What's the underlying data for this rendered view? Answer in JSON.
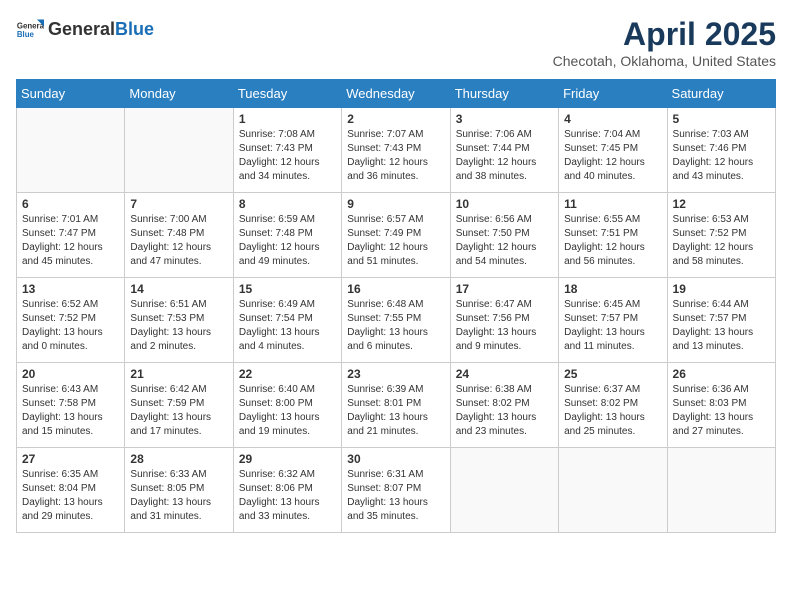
{
  "header": {
    "logo_general": "General",
    "logo_blue": "Blue",
    "main_title": "April 2025",
    "subtitle": "Checotah, Oklahoma, United States"
  },
  "days_of_week": [
    "Sunday",
    "Monday",
    "Tuesday",
    "Wednesday",
    "Thursday",
    "Friday",
    "Saturday"
  ],
  "weeks": [
    [
      {
        "day": "",
        "sunrise": "",
        "sunset": "",
        "daylight": ""
      },
      {
        "day": "",
        "sunrise": "",
        "sunset": "",
        "daylight": ""
      },
      {
        "day": "1",
        "sunrise": "Sunrise: 7:08 AM",
        "sunset": "Sunset: 7:43 PM",
        "daylight": "Daylight: 12 hours and 34 minutes."
      },
      {
        "day": "2",
        "sunrise": "Sunrise: 7:07 AM",
        "sunset": "Sunset: 7:43 PM",
        "daylight": "Daylight: 12 hours and 36 minutes."
      },
      {
        "day": "3",
        "sunrise": "Sunrise: 7:06 AM",
        "sunset": "Sunset: 7:44 PM",
        "daylight": "Daylight: 12 hours and 38 minutes."
      },
      {
        "day": "4",
        "sunrise": "Sunrise: 7:04 AM",
        "sunset": "Sunset: 7:45 PM",
        "daylight": "Daylight: 12 hours and 40 minutes."
      },
      {
        "day": "5",
        "sunrise": "Sunrise: 7:03 AM",
        "sunset": "Sunset: 7:46 PM",
        "daylight": "Daylight: 12 hours and 43 minutes."
      }
    ],
    [
      {
        "day": "6",
        "sunrise": "Sunrise: 7:01 AM",
        "sunset": "Sunset: 7:47 PM",
        "daylight": "Daylight: 12 hours and 45 minutes."
      },
      {
        "day": "7",
        "sunrise": "Sunrise: 7:00 AM",
        "sunset": "Sunset: 7:48 PM",
        "daylight": "Daylight: 12 hours and 47 minutes."
      },
      {
        "day": "8",
        "sunrise": "Sunrise: 6:59 AM",
        "sunset": "Sunset: 7:48 PM",
        "daylight": "Daylight: 12 hours and 49 minutes."
      },
      {
        "day": "9",
        "sunrise": "Sunrise: 6:57 AM",
        "sunset": "Sunset: 7:49 PM",
        "daylight": "Daylight: 12 hours and 51 minutes."
      },
      {
        "day": "10",
        "sunrise": "Sunrise: 6:56 AM",
        "sunset": "Sunset: 7:50 PM",
        "daylight": "Daylight: 12 hours and 54 minutes."
      },
      {
        "day": "11",
        "sunrise": "Sunrise: 6:55 AM",
        "sunset": "Sunset: 7:51 PM",
        "daylight": "Daylight: 12 hours and 56 minutes."
      },
      {
        "day": "12",
        "sunrise": "Sunrise: 6:53 AM",
        "sunset": "Sunset: 7:52 PM",
        "daylight": "Daylight: 12 hours and 58 minutes."
      }
    ],
    [
      {
        "day": "13",
        "sunrise": "Sunrise: 6:52 AM",
        "sunset": "Sunset: 7:52 PM",
        "daylight": "Daylight: 13 hours and 0 minutes."
      },
      {
        "day": "14",
        "sunrise": "Sunrise: 6:51 AM",
        "sunset": "Sunset: 7:53 PM",
        "daylight": "Daylight: 13 hours and 2 minutes."
      },
      {
        "day": "15",
        "sunrise": "Sunrise: 6:49 AM",
        "sunset": "Sunset: 7:54 PM",
        "daylight": "Daylight: 13 hours and 4 minutes."
      },
      {
        "day": "16",
        "sunrise": "Sunrise: 6:48 AM",
        "sunset": "Sunset: 7:55 PM",
        "daylight": "Daylight: 13 hours and 6 minutes."
      },
      {
        "day": "17",
        "sunrise": "Sunrise: 6:47 AM",
        "sunset": "Sunset: 7:56 PM",
        "daylight": "Daylight: 13 hours and 9 minutes."
      },
      {
        "day": "18",
        "sunrise": "Sunrise: 6:45 AM",
        "sunset": "Sunset: 7:57 PM",
        "daylight": "Daylight: 13 hours and 11 minutes."
      },
      {
        "day": "19",
        "sunrise": "Sunrise: 6:44 AM",
        "sunset": "Sunset: 7:57 PM",
        "daylight": "Daylight: 13 hours and 13 minutes."
      }
    ],
    [
      {
        "day": "20",
        "sunrise": "Sunrise: 6:43 AM",
        "sunset": "Sunset: 7:58 PM",
        "daylight": "Daylight: 13 hours and 15 minutes."
      },
      {
        "day": "21",
        "sunrise": "Sunrise: 6:42 AM",
        "sunset": "Sunset: 7:59 PM",
        "daylight": "Daylight: 13 hours and 17 minutes."
      },
      {
        "day": "22",
        "sunrise": "Sunrise: 6:40 AM",
        "sunset": "Sunset: 8:00 PM",
        "daylight": "Daylight: 13 hours and 19 minutes."
      },
      {
        "day": "23",
        "sunrise": "Sunrise: 6:39 AM",
        "sunset": "Sunset: 8:01 PM",
        "daylight": "Daylight: 13 hours and 21 minutes."
      },
      {
        "day": "24",
        "sunrise": "Sunrise: 6:38 AM",
        "sunset": "Sunset: 8:02 PM",
        "daylight": "Daylight: 13 hours and 23 minutes."
      },
      {
        "day": "25",
        "sunrise": "Sunrise: 6:37 AM",
        "sunset": "Sunset: 8:02 PM",
        "daylight": "Daylight: 13 hours and 25 minutes."
      },
      {
        "day": "26",
        "sunrise": "Sunrise: 6:36 AM",
        "sunset": "Sunset: 8:03 PM",
        "daylight": "Daylight: 13 hours and 27 minutes."
      }
    ],
    [
      {
        "day": "27",
        "sunrise": "Sunrise: 6:35 AM",
        "sunset": "Sunset: 8:04 PM",
        "daylight": "Daylight: 13 hours and 29 minutes."
      },
      {
        "day": "28",
        "sunrise": "Sunrise: 6:33 AM",
        "sunset": "Sunset: 8:05 PM",
        "daylight": "Daylight: 13 hours and 31 minutes."
      },
      {
        "day": "29",
        "sunrise": "Sunrise: 6:32 AM",
        "sunset": "Sunset: 8:06 PM",
        "daylight": "Daylight: 13 hours and 33 minutes."
      },
      {
        "day": "30",
        "sunrise": "Sunrise: 6:31 AM",
        "sunset": "Sunset: 8:07 PM",
        "daylight": "Daylight: 13 hours and 35 minutes."
      },
      {
        "day": "",
        "sunrise": "",
        "sunset": "",
        "daylight": ""
      },
      {
        "day": "",
        "sunrise": "",
        "sunset": "",
        "daylight": ""
      },
      {
        "day": "",
        "sunrise": "",
        "sunset": "",
        "daylight": ""
      }
    ]
  ]
}
